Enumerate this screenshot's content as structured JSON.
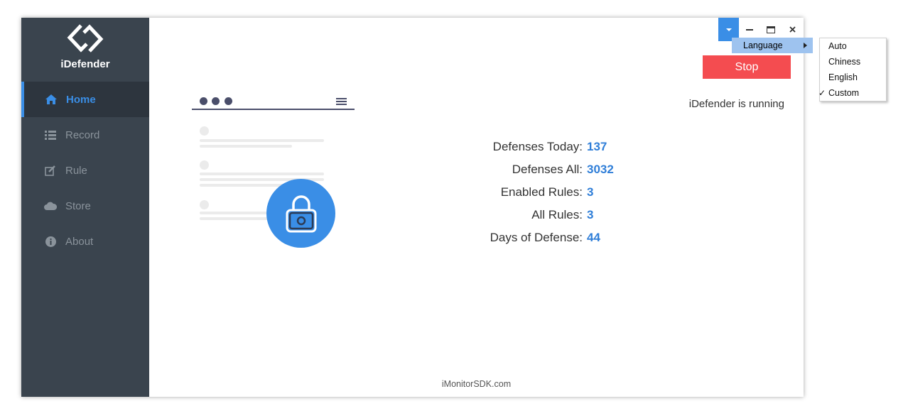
{
  "app": {
    "name": "iDefender"
  },
  "sidebar": {
    "items": [
      {
        "label": "Home",
        "icon": "home-icon",
        "active": true
      },
      {
        "label": "Record",
        "icon": "list-icon",
        "active": false
      },
      {
        "label": "Rule",
        "icon": "edit-icon",
        "active": false
      },
      {
        "label": "Store",
        "icon": "cloud-icon",
        "active": false
      },
      {
        "label": "About",
        "icon": "info-icon",
        "active": false
      }
    ]
  },
  "titlebar": {
    "controls": [
      "dropdown-icon",
      "minimize-icon",
      "maximize-icon",
      "close-icon"
    ]
  },
  "menu": {
    "language_label": "Language",
    "submenu": [
      {
        "label": "Auto",
        "checked": false
      },
      {
        "label": "Chiness",
        "checked": false
      },
      {
        "label": "English",
        "checked": false
      },
      {
        "label": "Custom",
        "checked": true
      }
    ],
    "check_mark": "✓"
  },
  "main": {
    "stop_label": "Stop",
    "status": "iDefender is running",
    "stats": [
      {
        "label": "Defenses Today:",
        "value": "137"
      },
      {
        "label": "Defenses All:",
        "value": "3032"
      },
      {
        "label": "Enabled Rules:",
        "value": "3"
      },
      {
        "label": "All Rules:",
        "value": "3"
      },
      {
        "label": "Days of Defense:",
        "value": "44"
      }
    ]
  },
  "footer": {
    "text": "iMonitorSDK.com"
  },
  "colors": {
    "sidebar_bg": "#3a444e",
    "accent": "#3a8ee6",
    "stop_button": "#f44c50",
    "stat_value": "#2f7ed8"
  }
}
